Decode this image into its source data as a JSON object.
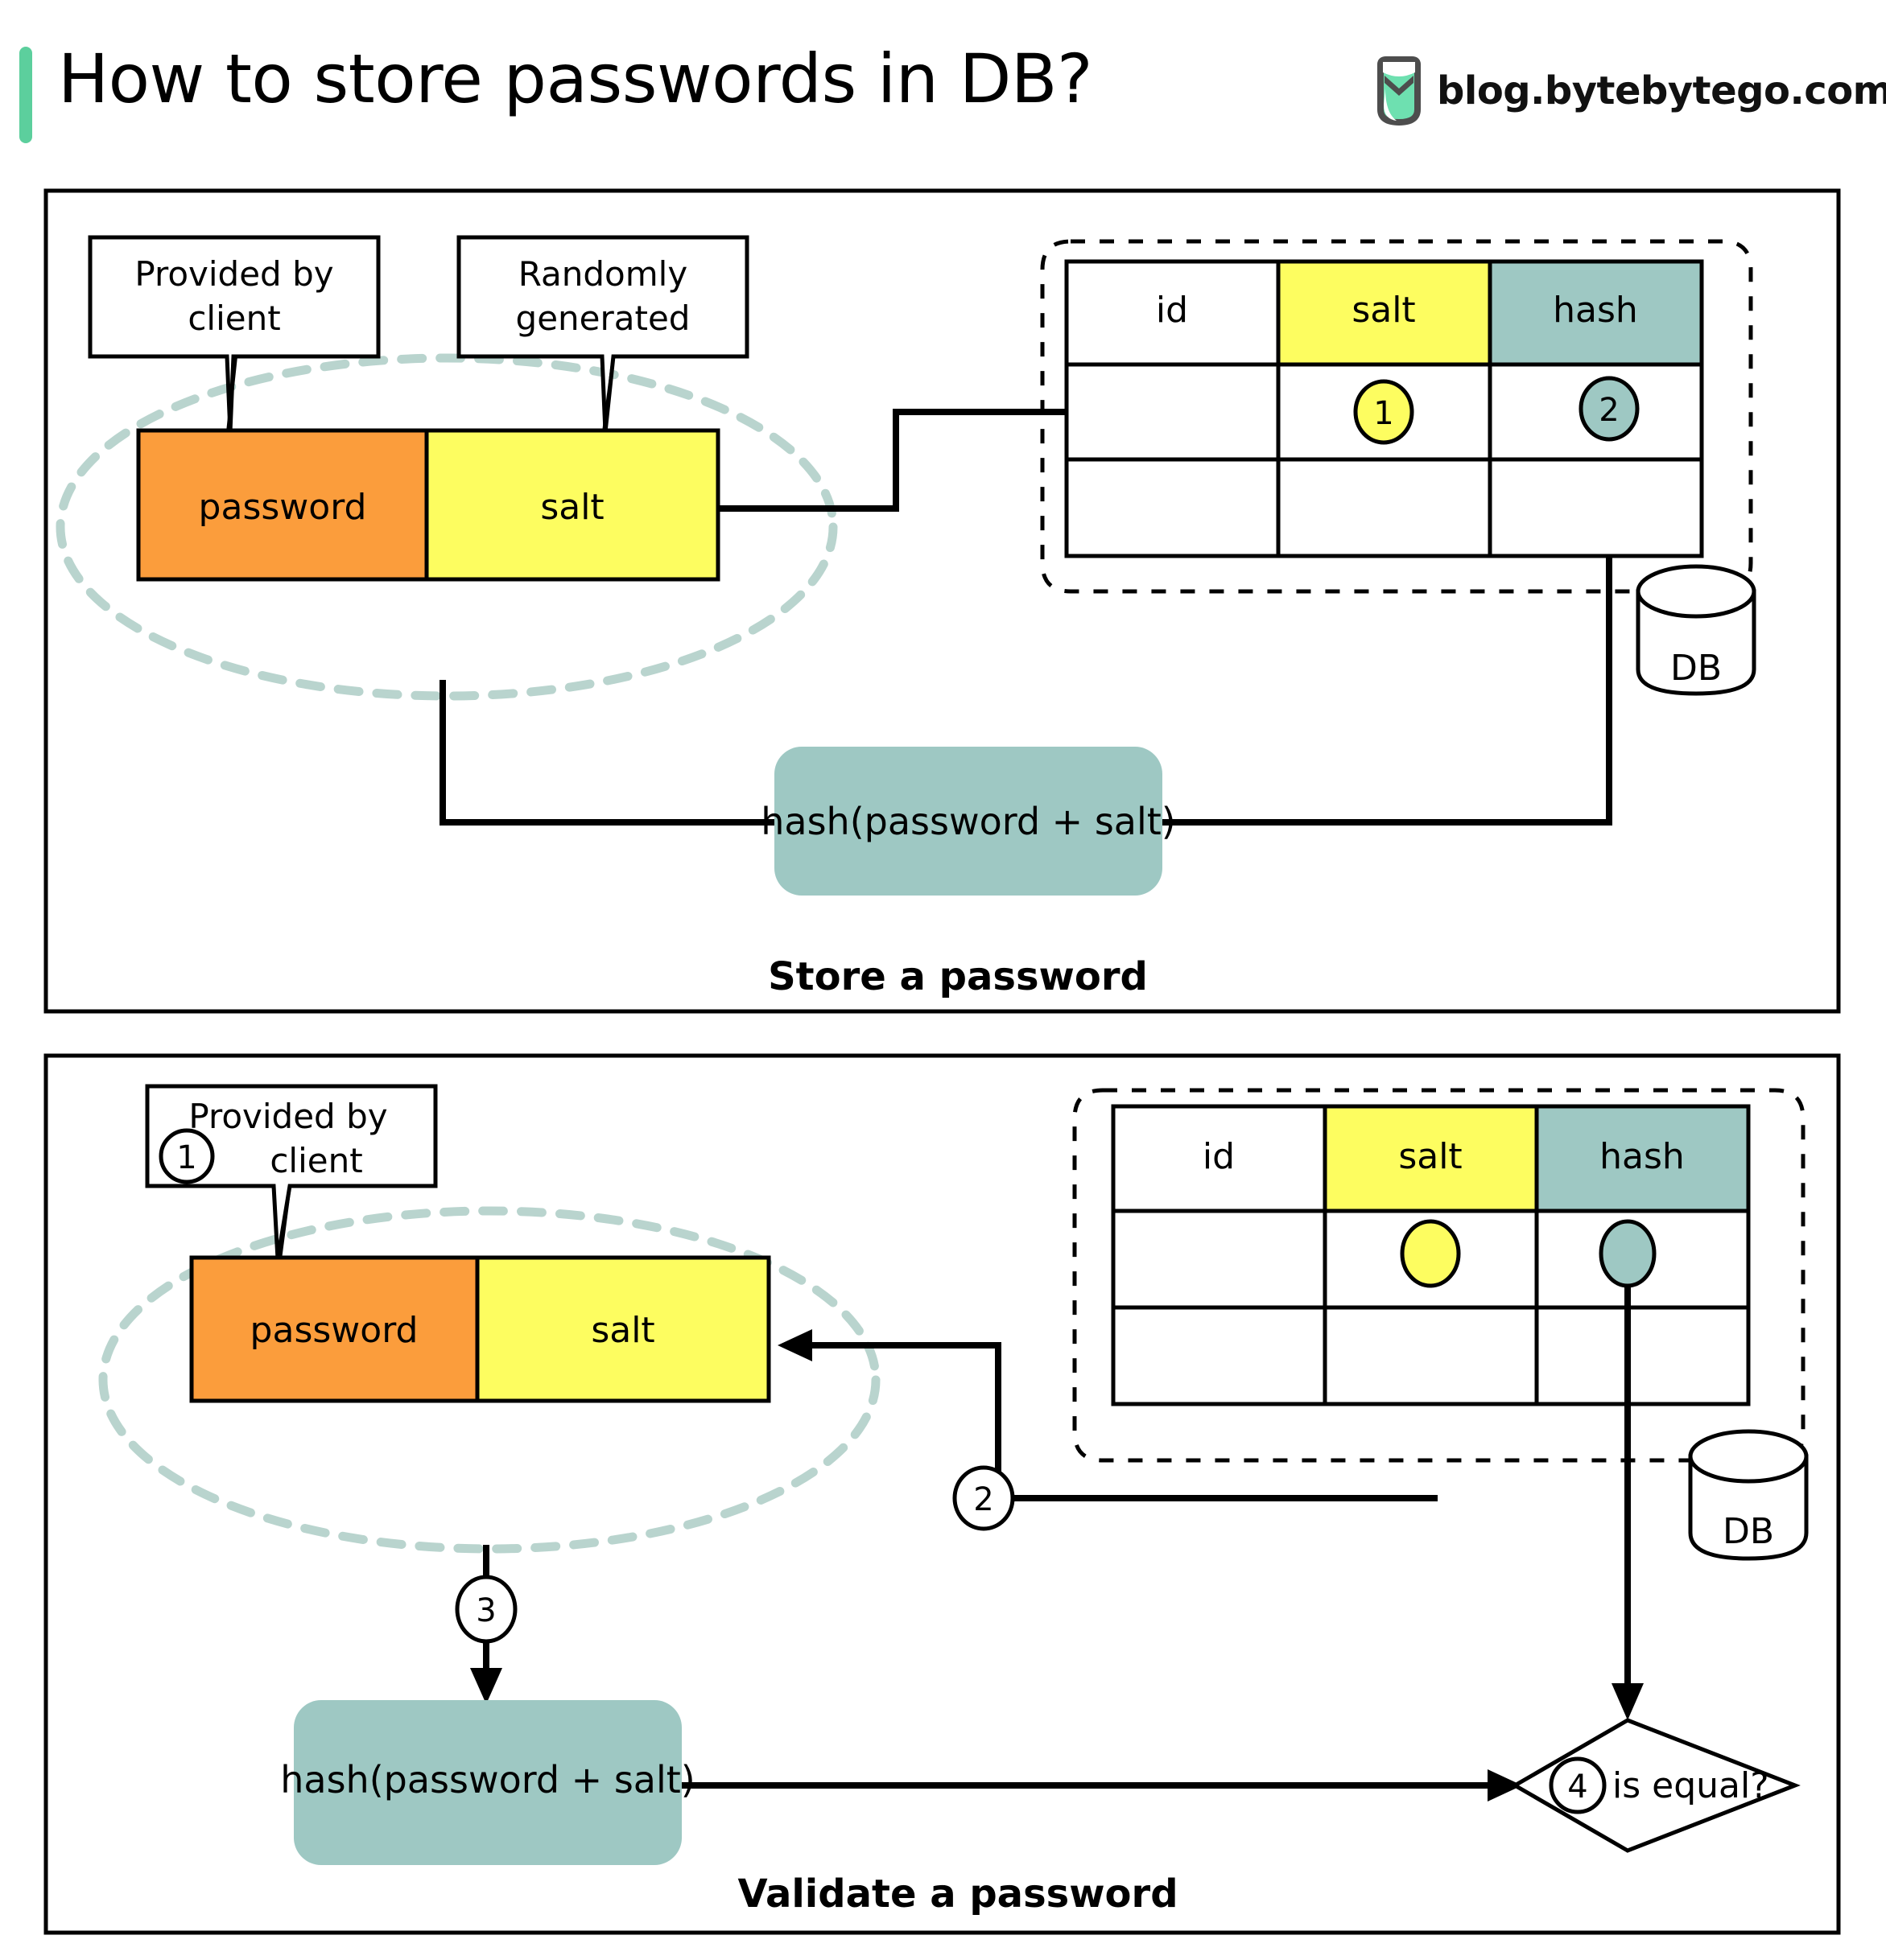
{
  "header": {
    "title": "How to store passwords in DB?",
    "brand_text": "blog.bytebytego.com",
    "accent_color": "#5ccf9d",
    "logo_icon": "bytebytego-logo-icon"
  },
  "colors": {
    "password": "#fb9d3c",
    "salt": "#fdfd60",
    "hash": "#9ec8c3",
    "grouping_ellipse": "#b9d4ce",
    "outline": "#000000"
  },
  "panels": [
    {
      "id": "store",
      "caption": "Store a password",
      "callouts": [
        {
          "label": "Provided by\nclient",
          "line1": "Provided by",
          "line2": "client",
          "badge": null
        },
        {
          "label": "Randomly\ngenerated",
          "line1": "Randomly",
          "line2": "generated",
          "badge": null
        }
      ],
      "input_boxes": [
        {
          "label": "password",
          "color": "#fb9d3c"
        },
        {
          "label": "salt",
          "color": "#fdfd60"
        }
      ],
      "hash_node": "hash(password + salt)",
      "db_label": "DB",
      "table": {
        "headers": [
          "id",
          "salt",
          "hash"
        ],
        "header_colors": [
          "#ffffff",
          "#fdfd60",
          "#9ec8c3"
        ],
        "rows": [
          {
            "id": "",
            "salt": "1",
            "hash": "2"
          },
          {
            "id": "",
            "salt": "",
            "hash": ""
          }
        ]
      },
      "step_badges": [
        {
          "number": "1",
          "color": "#fdfd60",
          "target": "salt-cell"
        },
        {
          "number": "2",
          "color": "#9ec8c3",
          "target": "hash-cell"
        }
      ]
    },
    {
      "id": "validate",
      "caption": "Validate a password",
      "callouts": [
        {
          "label": "Provided by\nclient",
          "line1": "Provided by",
          "line2": "client",
          "badge": "1"
        }
      ],
      "input_boxes": [
        {
          "label": "password",
          "color": "#fb9d3c"
        },
        {
          "label": "salt",
          "color": "#fdfd60"
        }
      ],
      "hash_node": "hash(password + salt)",
      "db_label": "DB",
      "decision": {
        "badge": "4",
        "label": "is equal?"
      },
      "table": {
        "headers": [
          "id",
          "salt",
          "hash"
        ],
        "header_colors": [
          "#ffffff",
          "#fdfd60",
          "#9ec8c3"
        ],
        "rows": [
          {
            "id": "",
            "salt": "",
            "hash": ""
          },
          {
            "id": "",
            "salt": "",
            "hash": ""
          }
        ]
      },
      "step_badges": [
        {
          "number": "1",
          "color": "#ffffff",
          "target": "callout-provided-by-client"
        },
        {
          "number": "2",
          "color": "#ffffff",
          "target": "salt-fetch-arrow"
        },
        {
          "number": "3",
          "color": "#ffffff",
          "target": "hash-arrow"
        },
        {
          "number": "4",
          "color": "#ffffff",
          "target": "decision-diamond"
        }
      ]
    }
  ]
}
